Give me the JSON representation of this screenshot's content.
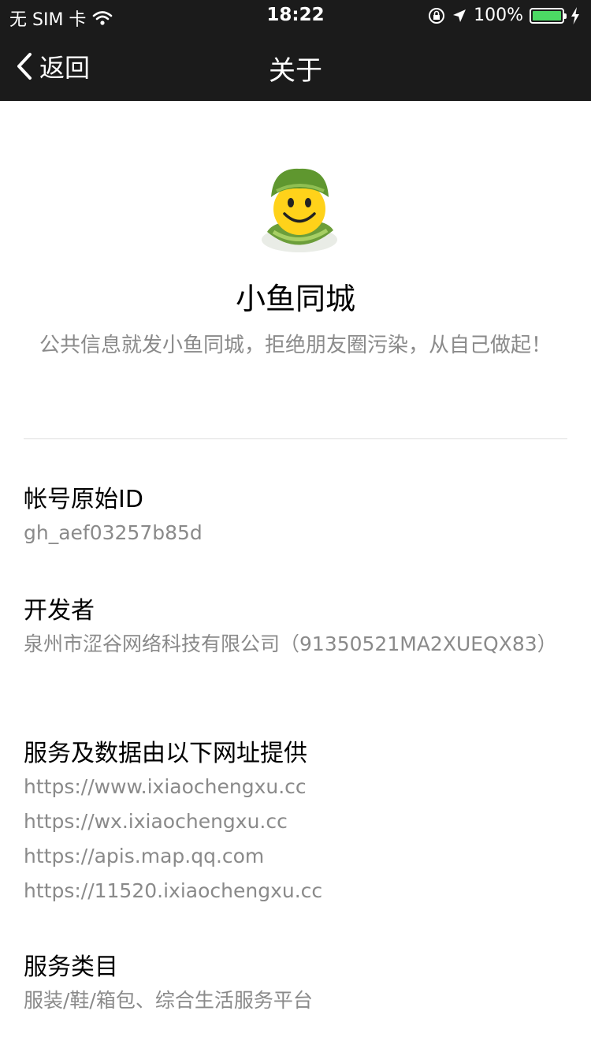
{
  "status_bar": {
    "carrier": "无 SIM 卡",
    "time": "18:22",
    "battery": "100%",
    "battery_level": 1.0,
    "battery_color": "#4cd964"
  },
  "nav": {
    "back_label": "返回",
    "title": "关于"
  },
  "app": {
    "name": "小鱼同城",
    "description": "公共信息就发小鱼同城，拒绝朋友圈污染，从自己做起！"
  },
  "sections": {
    "account": {
      "label": "帐号原始ID",
      "value": "gh_aef03257b85d"
    },
    "developer": {
      "label": "开发者",
      "value": "泉州市涩谷网络科技有限公司（91350521MA2XUEQX83）"
    },
    "domains": {
      "label": "服务及数据由以下网址提供",
      "items": [
        "https://www.ixiaochengxu.cc",
        "https://wx.ixiaochengxu.cc",
        "https://apis.map.qq.com",
        "https://11520.ixiaochengxu.cc"
      ]
    },
    "category": {
      "label": "服务类目",
      "value": "服装/鞋/箱包、综合生活服务平台"
    }
  },
  "colors": {
    "header_bg": "#1b1b1b",
    "secondary_text": "#8a8a8a"
  }
}
